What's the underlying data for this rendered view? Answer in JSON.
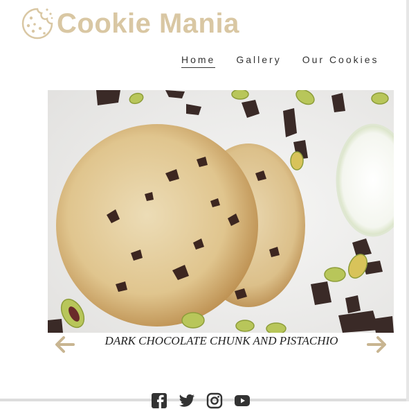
{
  "site": {
    "title": "Cookie Mania"
  },
  "nav": {
    "items": [
      {
        "label": "Home",
        "active": true
      },
      {
        "label": "Gallery",
        "active": false
      },
      {
        "label": "Our Cookies",
        "active": false
      }
    ]
  },
  "slider": {
    "caption": "DARK CHOCOLATE CHUNK AND PISTACHIO"
  },
  "colors": {
    "brand": "#d9c7a3",
    "arrow": "#c8b591",
    "text": "#333333"
  },
  "social": {
    "icons": [
      "facebook-icon",
      "twitter-icon",
      "instagram-icon",
      "youtube-icon"
    ]
  }
}
